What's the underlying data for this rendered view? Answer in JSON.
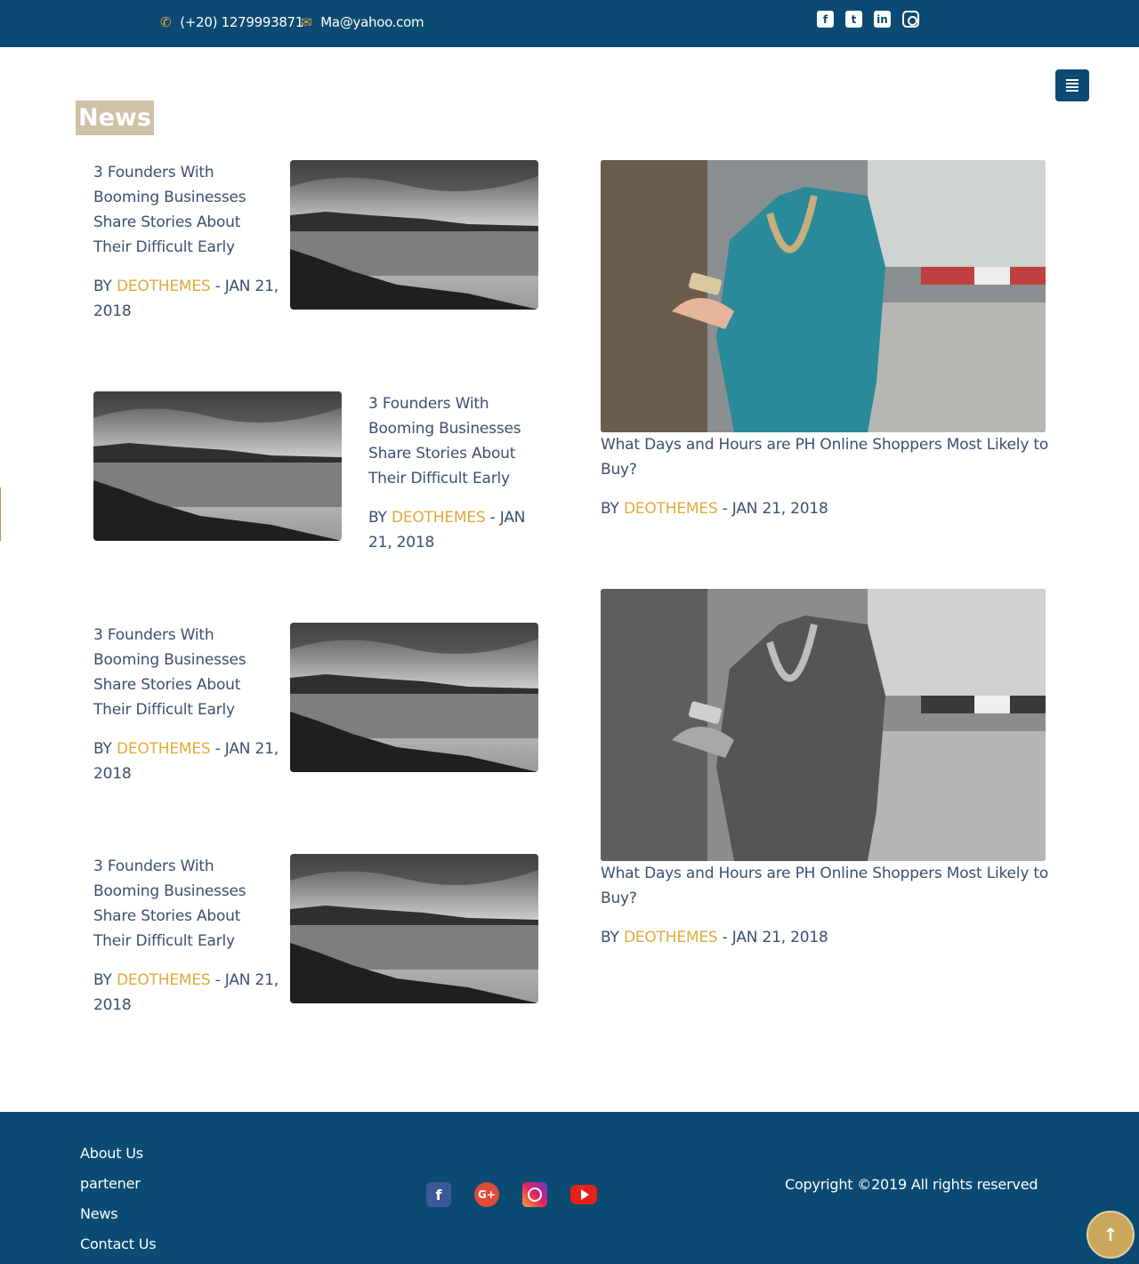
{
  "topbar": {
    "phone": "(+20) 1279993871",
    "email": "Ma@yahoo.com",
    "phone_icon": "phone-icon",
    "email_icon": "envelope-icon",
    "social": [
      "facebook-icon",
      "twitter-icon",
      "linkedin-icon",
      "instagram-icon"
    ]
  },
  "menu_button_icon": "menu-icon",
  "section_title": "News",
  "small_cards": [
    {
      "title": "3 Founders With Booming Businesses Share Stories About Their Difficult Early",
      "by": "BY",
      "author": "DEOTHEMES",
      "date": " - JAN 21, 2018"
    },
    {
      "title": "3 Founders With Booming Businesses Share Stories About Their Difficult Early",
      "by": "BY",
      "author": "DEOTHEMES",
      "date": " - JAN 21, 2018"
    },
    {
      "title": "3 Founders With Booming Businesses Share Stories About Their Difficult Early",
      "by": "BY",
      "author": "DEOTHEMES",
      "date": " - JAN 21, 2018"
    },
    {
      "title": "3 Founders With Booming Businesses Share Stories About Their Difficult Early",
      "by": "BY",
      "author": "DEOTHEMES",
      "date": " - JAN 21, 2018"
    }
  ],
  "big_cards": [
    {
      "title": "What Days and Hours are PH Online Shoppers Most Likely to Buy?",
      "by": "BY",
      "author": "DEOTHEMES",
      "date": " - JAN 21, 2018"
    },
    {
      "title": "What Days and Hours are PH Online Shoppers Most Likely to Buy?",
      "by": "BY",
      "author": "DEOTHEMES",
      "date": " - JAN 21, 2018"
    }
  ],
  "footer": {
    "links": [
      "About Us",
      "partener",
      "News",
      "Contact Us"
    ],
    "social": [
      "facebook-icon",
      "google-plus-icon",
      "instagram-icon",
      "youtube-icon"
    ],
    "copyright": "Copyright ©2019 All rights reserved"
  },
  "back_to_top_icon": "arrow-up-icon",
  "colors": {
    "primary": "#0b4a72",
    "accent": "#e2a93b",
    "title_bg": "#cfc0a8",
    "text": "#3b4f72"
  }
}
